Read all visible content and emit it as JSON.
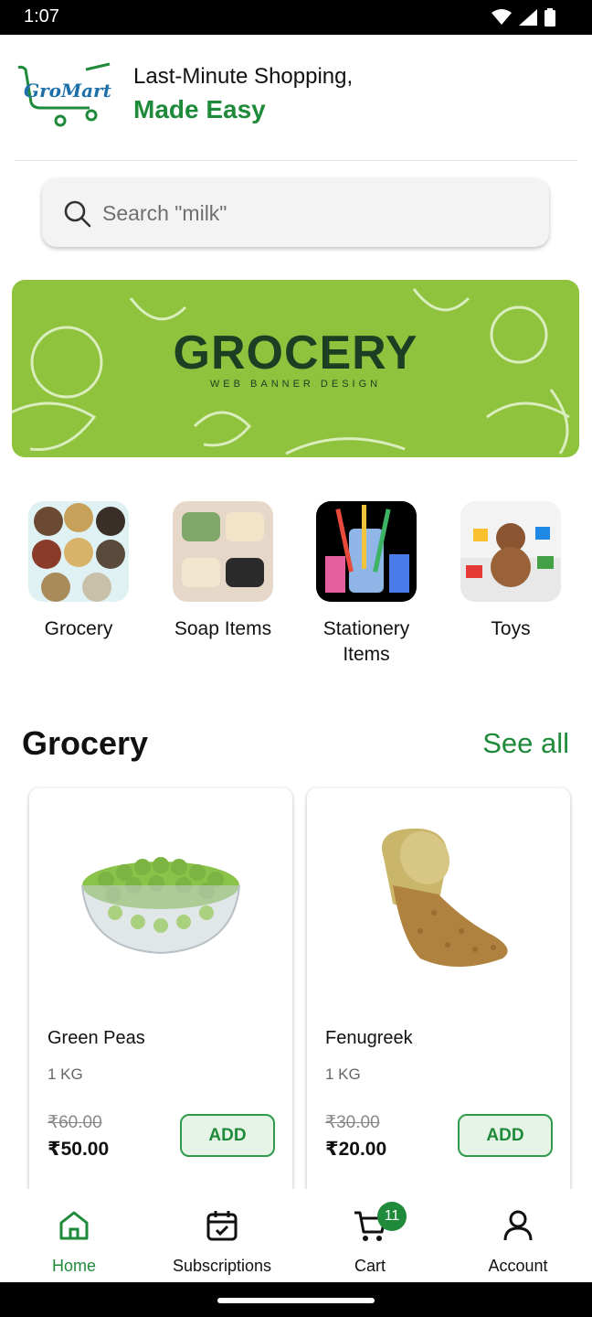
{
  "status_bar": {
    "time": "1:07",
    "icons": [
      "wifi-icon",
      "signal-icon",
      "battery-icon"
    ]
  },
  "header": {
    "logo_text": "GroMart",
    "tagline_line1": "Last-Minute Shopping,",
    "tagline_line2": "Made Easy"
  },
  "search": {
    "placeholder": "Search \"milk\""
  },
  "banner": {
    "title": "GROCERY",
    "subtitle": "WEB BANNER DESIGN"
  },
  "categories": [
    {
      "label": "Grocery"
    },
    {
      "label": "Soap Items"
    },
    {
      "label": "Stationery Items"
    },
    {
      "label": "Toys"
    }
  ],
  "section": {
    "title": "Grocery",
    "see_all": "See all"
  },
  "products": [
    {
      "name": "Green Peas",
      "qty": "1 KG",
      "mrp": "₹60.00",
      "price": "₹50.00",
      "add_label": "ADD"
    },
    {
      "name": "Fenugreek",
      "qty": "1 KG",
      "mrp": "₹30.00",
      "price": "₹20.00",
      "add_label": "ADD"
    }
  ],
  "bottom_nav": {
    "items": [
      {
        "label": "Home",
        "icon": "home-icon",
        "active": true
      },
      {
        "label": "Subscriptions",
        "icon": "calendar-check-icon"
      },
      {
        "label": "Cart",
        "icon": "cart-icon",
        "badge": "11"
      },
      {
        "label": "Account",
        "icon": "person-icon"
      }
    ]
  },
  "colors": {
    "brand_green": "#1e8a3a",
    "banner_green": "#8fc33e",
    "text": "#111111"
  }
}
